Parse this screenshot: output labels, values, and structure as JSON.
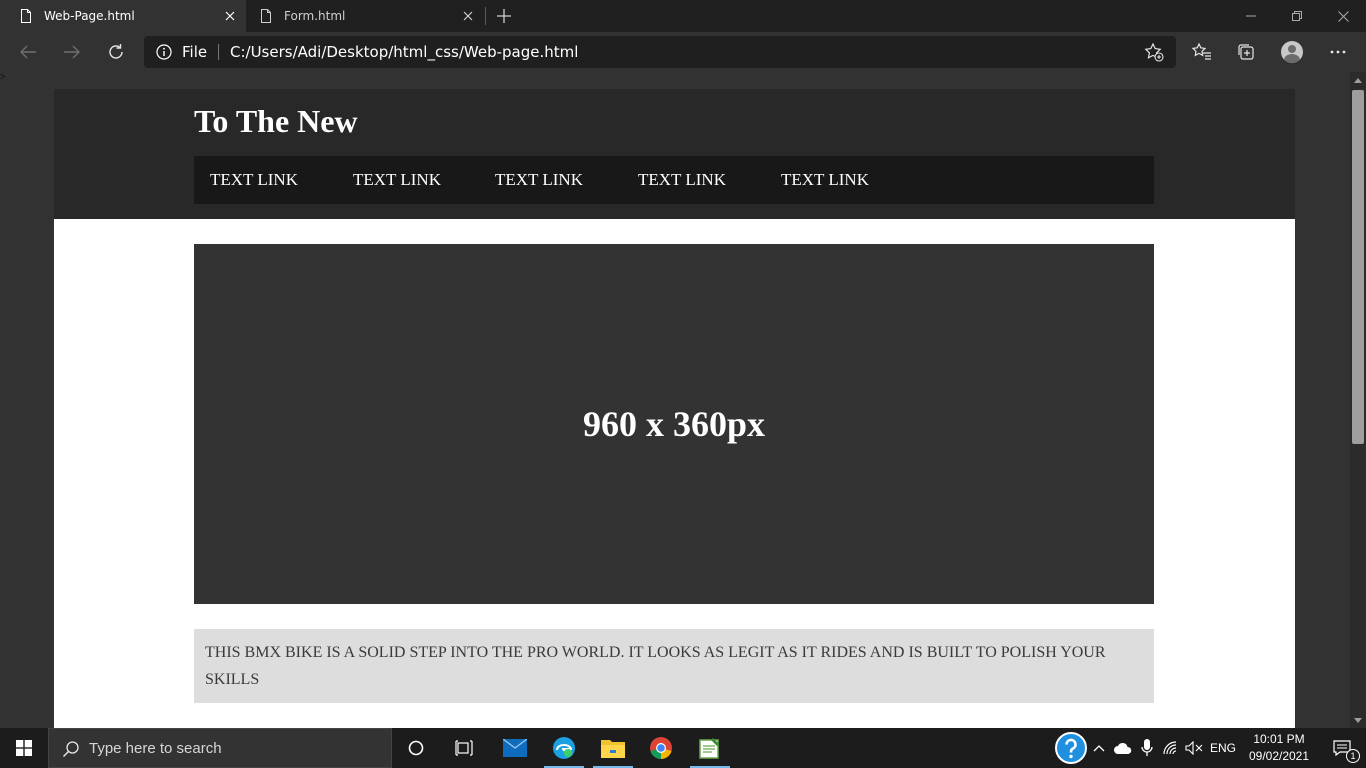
{
  "browser": {
    "tabs": [
      {
        "title": "Web-Page.html",
        "active": true
      },
      {
        "title": "Form.html",
        "active": false
      }
    ],
    "address": {
      "scheme_label": "File",
      "url": "C:/Users/Adi/Desktop/html_css/Web-page.html"
    },
    "icons": {
      "back": "back-arrow-icon",
      "forward": "forward-arrow-icon",
      "refresh": "refresh-icon",
      "info": "info-icon",
      "add_favorite": "add-favorite-icon",
      "favorites": "favorites-icon",
      "collections": "collections-icon",
      "profile": "profile-avatar",
      "more": "more-icon"
    }
  },
  "page": {
    "stray_text": ">",
    "site_title": "To The New",
    "nav_links": [
      "TEXT LINK",
      "TEXT LINK",
      "TEXT LINK",
      "TEXT LINK",
      "TEXT LINK"
    ],
    "hero_text": "960 x 360px",
    "description": "THIS BMX BIKE IS A SOLID STEP INTO THE PRO WORLD. IT LOOKS AS LEGIT AS IT RIDES AND IS BUILT TO POLISH YOUR SKILLS"
  },
  "taskbar": {
    "search_placeholder": "Type here to search",
    "language": "ENG",
    "time": "10:01 PM",
    "date": "09/02/2021",
    "notification_count": "1"
  },
  "colors": {
    "chrome_dark": "#202020",
    "chrome": "#323232",
    "site_header": "#282828",
    "site_nav": "#181818",
    "hero": "#333333",
    "description_bg": "#dddddd"
  }
}
